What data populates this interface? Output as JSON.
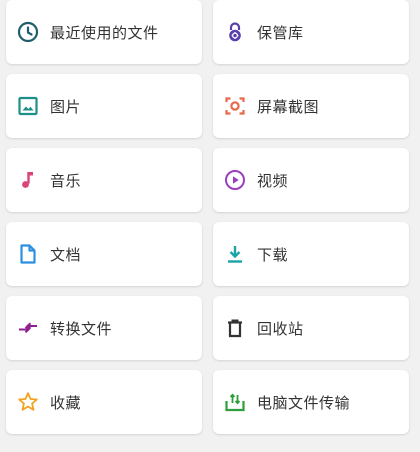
{
  "colors": {
    "background": "#f1f1f1",
    "card": "#ffffff",
    "text": "#333333",
    "recent": "#1d5e6b",
    "vault": "#5b3fae",
    "image": "#1e8f86",
    "screenshot": "#e8684a",
    "music": "#d9437a",
    "video": "#9a3fbf",
    "document": "#2c8fe0",
    "download": "#1ca3a8",
    "convert": "#8f1f8f",
    "trash": "#333333",
    "favorite": "#f2a31f",
    "transfer": "#2e9e3a"
  },
  "tiles": [
    {
      "label": "最近使用的文件",
      "icon": "clock-icon"
    },
    {
      "label": "保管库",
      "icon": "lock-icon"
    },
    {
      "label": "图片",
      "icon": "image-icon"
    },
    {
      "label": "屏幕截图",
      "icon": "screenshot-icon"
    },
    {
      "label": "音乐",
      "icon": "music-note-icon"
    },
    {
      "label": "视频",
      "icon": "play-circle-icon"
    },
    {
      "label": "文档",
      "icon": "document-icon"
    },
    {
      "label": "下载",
      "icon": "download-icon"
    },
    {
      "label": "转换文件",
      "icon": "convert-arrows-icon"
    },
    {
      "label": "回收站",
      "icon": "trash-icon"
    },
    {
      "label": "收藏",
      "icon": "star-icon"
    },
    {
      "label": "电脑文件传输",
      "icon": "upload-tray-icon"
    }
  ]
}
